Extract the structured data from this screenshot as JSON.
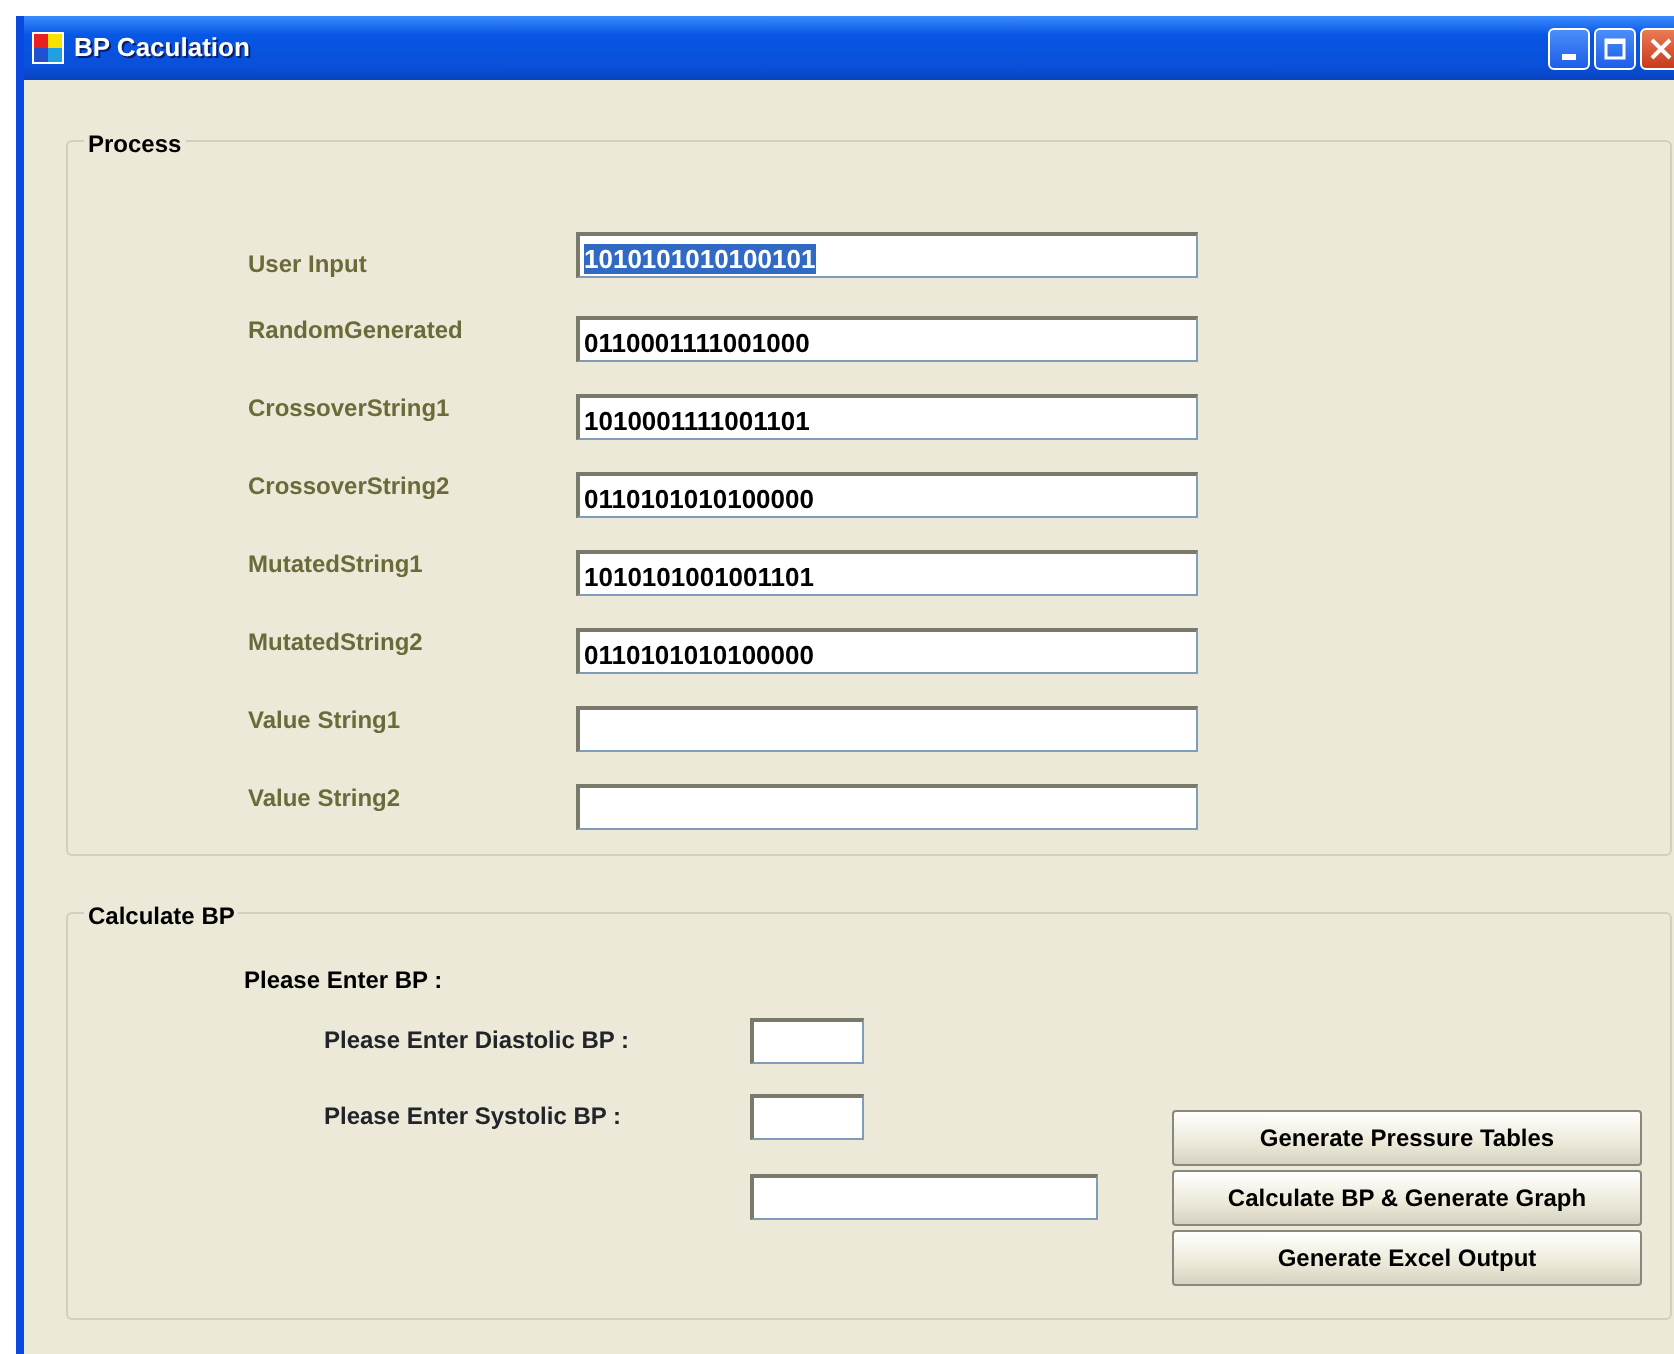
{
  "window": {
    "title": "BP Caculation"
  },
  "process": {
    "title": "Process",
    "fields": [
      {
        "label": "User Input",
        "value": "1010101010100101",
        "selected": true
      },
      {
        "label": "RandomGenerated",
        "value": "0110001111001000",
        "selected": false
      },
      {
        "label": "CrossoverString1",
        "value": "1010001111001101",
        "selected": false
      },
      {
        "label": "CrossoverString2",
        "value": "0110101010100000",
        "selected": false
      },
      {
        "label": "MutatedString1",
        "value": "1010101001001101",
        "selected": false
      },
      {
        "label": "MutatedString2",
        "value": "0110101010100000",
        "selected": false
      },
      {
        "label": "Value String1",
        "selected": false
      },
      {
        "label": "Value String2",
        "selected": false
      }
    ]
  },
  "calculate": {
    "title": "Calculate BP",
    "heading": "Please Enter BP :",
    "fields": [
      {
        "label": "Please Enter Diastolic BP :"
      },
      {
        "label": "Please Enter Systolic BP :"
      }
    ],
    "buttons": [
      "Generate Pressure Tables",
      "Calculate BP & Generate Graph",
      "Generate Excel Output"
    ]
  }
}
